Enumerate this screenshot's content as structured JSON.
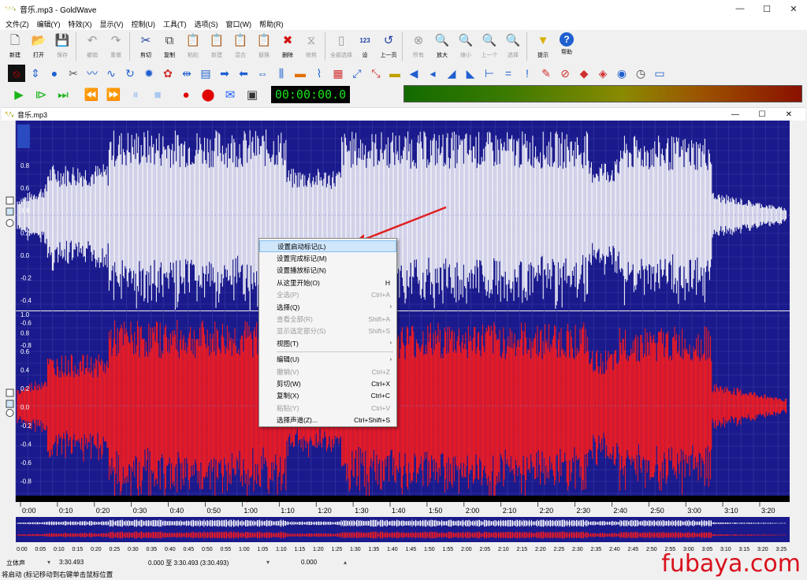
{
  "window": {
    "title": "音乐.mp3 - GoldWave",
    "min": "—",
    "max": "☐",
    "close": "✕"
  },
  "menu": [
    "文件(Z)",
    "编辑(Y)",
    "特效(X)",
    "显示(V)",
    "控制(U)",
    "工具(T)",
    "选项(S)",
    "窗口(W)",
    "帮助(R)"
  ],
  "toolbar": [
    {
      "name": "new",
      "label": "新建",
      "icon": "🗋",
      "disabled": false
    },
    {
      "name": "open",
      "label": "打开",
      "icon": "📂",
      "disabled": false
    },
    {
      "name": "save",
      "label": "保存",
      "icon": "💾",
      "disabled": true
    },
    {
      "name": "undo",
      "label": "撤销",
      "icon": "↶",
      "disabled": true
    },
    {
      "name": "redo",
      "label": "重做",
      "icon": "↷",
      "disabled": true
    },
    {
      "name": "cut",
      "label": "剪切",
      "icon": "✂",
      "disabled": false
    },
    {
      "name": "copy",
      "label": "复制",
      "icon": "⧉",
      "disabled": false
    },
    {
      "name": "paste",
      "label": "粘贴",
      "icon": "📋",
      "disabled": true
    },
    {
      "name": "paste-new",
      "label": "新建",
      "icon": "📋",
      "disabled": true
    },
    {
      "name": "mix",
      "label": "混合",
      "icon": "📋",
      "disabled": true
    },
    {
      "name": "replace",
      "label": "替换",
      "icon": "📋",
      "disabled": true
    },
    {
      "name": "delete",
      "label": "删除",
      "icon": "✖",
      "disabled": false
    },
    {
      "name": "trim",
      "label": "修剪",
      "icon": "⧖",
      "disabled": true
    },
    {
      "name": "select-all",
      "label": "全部选择",
      "icon": "▯",
      "disabled": true
    },
    {
      "name": "set",
      "label": "设",
      "icon": "123",
      "disabled": false
    },
    {
      "name": "prev-page",
      "label": "上一页",
      "icon": "↺",
      "disabled": false
    },
    {
      "name": "all",
      "label": "所有",
      "icon": "⊗",
      "disabled": true
    },
    {
      "name": "zoom-in",
      "label": "放大",
      "icon": "🔍",
      "disabled": false
    },
    {
      "name": "zoom-out",
      "label": "缩小",
      "icon": "🔍",
      "disabled": true
    },
    {
      "name": "previous",
      "label": "上一个",
      "icon": "🔍",
      "disabled": true
    },
    {
      "name": "selection",
      "label": "选择",
      "icon": "🔍",
      "disabled": true
    },
    {
      "name": "hint",
      "label": "提示",
      "icon": "▼",
      "disabled": false
    },
    {
      "name": "help",
      "label": "帮助",
      "icon": "?",
      "disabled": false
    }
  ],
  "effects_icons": [
    "stop-icon",
    "resize-icon",
    "globe-icon",
    "scissors-icon",
    "wave-icon",
    "swirl-icon",
    "loop-icon",
    "gear-icon",
    "palette-icon",
    "arrows-icon",
    "plot-icon",
    "arrow-right-icon",
    "arrow-left-icon",
    "compress-icon",
    "equalizer-icon",
    "spectrum-icon",
    "harp-icon",
    "panel-icon",
    "split-icon",
    "merge-icon",
    "color-bar-icon",
    "speaker-icon",
    "speaker2-icon",
    "ramp-up-icon",
    "ramp-down-icon",
    "marker-icon",
    "equals-icon",
    "exclaim-icon",
    "arrow-pen-icon",
    "no-icon",
    "red-arrow-icon",
    "diamond-icon",
    "circle-icon",
    "clock-icon",
    "chat-icon"
  ],
  "transport": {
    "time": "00:00:00.0",
    "buttons": [
      "play-icon",
      "play-selection-icon",
      "play-to-end-icon",
      "rewind-icon",
      "fast-forward-icon",
      "pause-icon",
      "stop-icon",
      "record-icon",
      "record-selection-icon",
      "mail-icon",
      "window-icon"
    ]
  },
  "child_window": {
    "title": "音乐.mp3",
    "min": "—",
    "max": "☐",
    "close": "✕"
  },
  "waveform": {
    "channel_top_color": "#ffffff",
    "channel_bottom_color": "#ff1a1a",
    "background": "#1a1a8c",
    "y_ticks_top": [
      "0.8",
      "0.6",
      "0.4",
      "0.2",
      "0.0",
      "-0.2",
      "-0.4",
      "-0.6",
      "-0.8"
    ],
    "y_ticks_bottom": [
      "1.0",
      "0.8",
      "0.6",
      "0.4",
      "0.2",
      "0.0",
      "-0.2",
      "-0.4",
      "-0.6",
      "-0.8"
    ],
    "time_ticks": [
      "0:00",
      "0:10",
      "0:20",
      "0:30",
      "0:40",
      "0:50",
      "1:00",
      "1:10",
      "1:20",
      "1:30",
      "1:40",
      "1:50",
      "2:00",
      "2:10",
      "2:20",
      "2:30",
      "2:40",
      "2:50",
      "3:00",
      "3:10",
      "3:20"
    ],
    "overview_ticks": [
      "0:00",
      "0:05",
      "0:10",
      "0:15",
      "0:20",
      "0:25",
      "0:30",
      "0:35",
      "0:40",
      "0:45",
      "0:50",
      "0:55",
      "1:00",
      "1:05",
      "1:10",
      "1:15",
      "1:20",
      "1:25",
      "1:30",
      "1:35",
      "1:40",
      "1:45",
      "1:50",
      "1:55",
      "2:00",
      "2:05",
      "2:10",
      "2:15",
      "2:20",
      "2:25",
      "2:30",
      "2:35",
      "2:40",
      "2:45",
      "2:50",
      "2:55",
      "3:00",
      "3:05",
      "3:10",
      "3:15",
      "3:20",
      "3:25"
    ]
  },
  "context_menu": [
    {
      "label": "设置启动标记(L)",
      "shortcut": "",
      "disabled": false,
      "highlight": true,
      "submenu": false
    },
    {
      "label": "设置完成标记(M)",
      "shortcut": "",
      "disabled": false,
      "highlight": false,
      "submenu": false
    },
    {
      "label": "设置播放标记(N)",
      "shortcut": "",
      "disabled": false,
      "highlight": false,
      "submenu": false
    },
    {
      "label": "从这里开始(O)",
      "shortcut": "H",
      "disabled": false,
      "highlight": false,
      "submenu": false
    },
    {
      "label": "全选(P)",
      "shortcut": "Ctrl+A",
      "disabled": true,
      "highlight": false,
      "submenu": false
    },
    {
      "label": "选择(Q)",
      "shortcut": "",
      "disabled": false,
      "highlight": false,
      "submenu": true
    },
    {
      "label": "查看全部(R)",
      "shortcut": "Shift+A",
      "disabled": true,
      "highlight": false,
      "submenu": false
    },
    {
      "label": "显示选定部分(S)",
      "shortcut": "Shift+S",
      "disabled": true,
      "highlight": false,
      "submenu": false
    },
    {
      "label": "视图(T)",
      "shortcut": "",
      "disabled": false,
      "highlight": false,
      "submenu": true,
      "sep_after": true
    },
    {
      "label": "编辑(U)",
      "shortcut": "",
      "disabled": false,
      "highlight": false,
      "submenu": true
    },
    {
      "label": "撤销(V)",
      "shortcut": "Ctrl+Z",
      "disabled": true,
      "highlight": false,
      "submenu": false
    },
    {
      "label": "剪切(W)",
      "shortcut": "Ctrl+X",
      "disabled": false,
      "highlight": false,
      "submenu": false
    },
    {
      "label": "复制(X)",
      "shortcut": "Ctrl+C",
      "disabled": false,
      "highlight": false,
      "submenu": false
    },
    {
      "label": "粘贴(Y)",
      "shortcut": "Ctrl+V",
      "disabled": true,
      "highlight": false,
      "submenu": false
    },
    {
      "label": "选择声道(Z)...",
      "shortcut": "Ctrl+Shift+S",
      "disabled": false,
      "highlight": false,
      "submenu": false
    }
  ],
  "status": {
    "channels": "立体声",
    "length": "3:30.493",
    "selection": "0.000 至 3:30.493 (3:30.493)",
    "position": "0.000",
    "hint": "将启动 (标记移动到右键单击鼠标位置"
  },
  "watermark": "fubaya.com"
}
